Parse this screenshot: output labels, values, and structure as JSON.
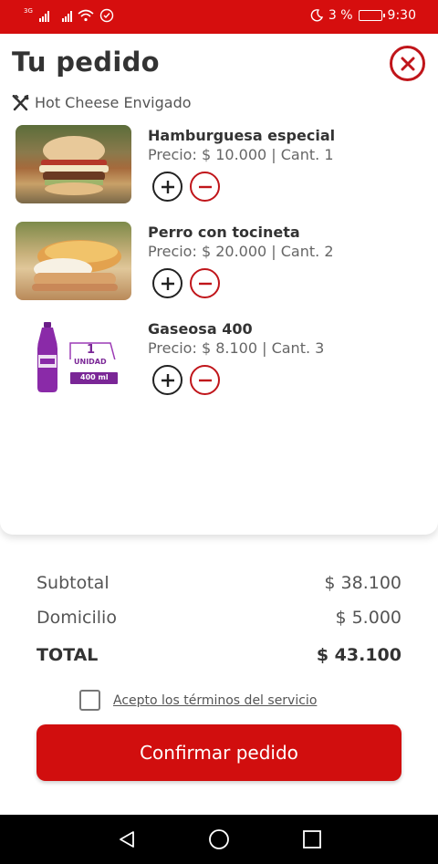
{
  "status_bar": {
    "net_tag": "3G",
    "battery_text": "3 %",
    "time": "9:30",
    "colors": {
      "bar": "#d60e0e",
      "text": "#ffffff"
    },
    "icons": [
      "signal-icon",
      "signal-icon",
      "wifi-icon",
      "sync-icon",
      "moon-icon",
      "battery-icon"
    ]
  },
  "header": {
    "title": "Tu pedido",
    "close_icon": "close-icon",
    "restaurant": "Hot Cheese Envigado",
    "restaurant_icon": "utensils-icon"
  },
  "items": [
    {
      "name": "Hamburguesa especial",
      "price_line": "Precio: $ 10.000 | Cant. 1",
      "image": "burger-image"
    },
    {
      "name": "Perro con tocineta",
      "price_line": "Precio: $ 20.000 | Cant. 2",
      "image": "hotdog-image"
    },
    {
      "name": "Gaseosa 400",
      "price_line": "Precio: $ 8.100 | Cant. 3",
      "image": "soda-bottle-image",
      "badge_qty": "1",
      "badge_unit": "UNIDAD",
      "badge_volume": "400 ml"
    }
  ],
  "summary": {
    "subtotal_label": "Subtotal",
    "subtotal_value": "$ 38.100",
    "delivery_label": "Domicilio",
    "delivery_value": "$ 5.000",
    "total_label": "TOTAL",
    "total_value": "$ 43.100"
  },
  "terms": {
    "label": "Acepto los términos del servicio",
    "checked": false
  },
  "confirm_button": {
    "label": "Confirmar pedido",
    "color": "#d10e0e"
  },
  "accent_color": "#c0151a"
}
